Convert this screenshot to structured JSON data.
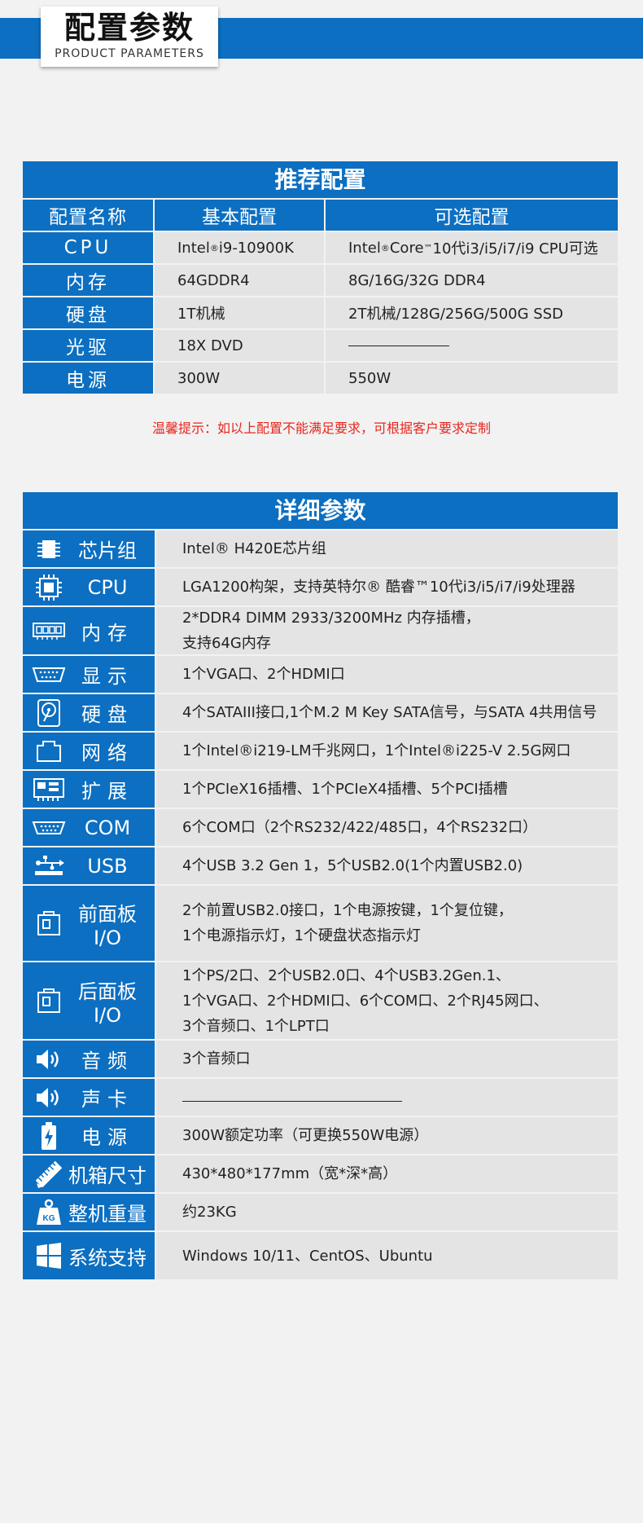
{
  "header": {
    "title_zh": "配置参数",
    "title_en": "PRODUCT PARAMETERS"
  },
  "recommended": {
    "title": "推荐配置",
    "columns": [
      "配置名称",
      "基本配置",
      "可选配置"
    ],
    "rows": [
      {
        "name": "CPU",
        "basic_a": "Intel",
        "basic_sup": "®",
        "basic_b": "i9-10900K",
        "optional_a": "Intel",
        "optional_sup": "®",
        "optional_b": "Core",
        "optional_sup2": "™",
        "optional_c": "10代i3/i5/i7/i9 CPU可选"
      },
      {
        "name": "内存",
        "basic_a": "64GDDR4",
        "optional_a": "8G/16G/32G DDR4"
      },
      {
        "name": "硬盘",
        "basic_a": "1T机械",
        "optional_a": "2T机械/128G/256G/500G SSD"
      },
      {
        "name": "光驱",
        "basic_a": "18X DVD",
        "optional_a": ""
      },
      {
        "name": "电源",
        "basic_a": "300W",
        "optional_a": "550W"
      }
    ]
  },
  "tip": "温馨提示：如以上配置不能满足要求，可根据客户要求定制",
  "detail": {
    "title": "详细参数",
    "rows": [
      {
        "icon": "chip-icon",
        "label": "芯片组",
        "lines": [
          "Intel® H420E芯片组"
        ]
      },
      {
        "icon": "cpu-icon",
        "label": "CPU",
        "lines": [
          "LGA1200构架，支持英特尔® 酷睿™10代i3/i5/i7/i9处理器"
        ]
      },
      {
        "icon": "memory-icon",
        "label": "内存",
        "lines": [
          "2*DDR4 DIMM 2933/3200MHz 内存插槽，",
          "支持64G内存"
        ]
      },
      {
        "icon": "vga-port-icon",
        "label": "显示",
        "lines": [
          "1个VGA口、2个HDMI口"
        ]
      },
      {
        "icon": "hard-disk-icon",
        "label": "硬盘",
        "lines": [
          "4个SATAIII接口,1个M.2 M Key SATA信号，与SATA 4共用信号"
        ]
      },
      {
        "icon": "network-icon",
        "label": "网络",
        "lines": [
          "1个Intel®i219-LM千兆网口，1个Intel®i225-V 2.5G网口"
        ]
      },
      {
        "icon": "expansion-icon",
        "label": "扩展",
        "lines": [
          "1个PCIeX16插槽、1个PCIeX4插槽、5个PCI插槽"
        ]
      },
      {
        "icon": "com-port-icon",
        "label": "COM",
        "lines": [
          "6个COM口（2个RS232/422/485口，4个RS232口）"
        ]
      },
      {
        "icon": "usb-icon",
        "label": "USB",
        "lines": [
          "4个USB 3.2 Gen 1，5个USB2.0(1个内置USB2.0)"
        ]
      },
      {
        "icon": "panel-icon",
        "label": "前面板I/O",
        "lines": [
          "2个前置USB2.0接口，1个电源按键，1个复位键，",
          "1个电源指示灯，1个硬盘状态指示灯"
        ]
      },
      {
        "icon": "panel-icon",
        "label": "后面板I/O",
        "lines": [
          "1个PS/2口、2个USB2.0口、4个USB3.2Gen.1、",
          "1个VGA口、2个HDMI口、6个COM口、2个RJ45网口、",
          "3个音频口、1个LPT口"
        ]
      },
      {
        "icon": "speaker-icon",
        "label": "音频",
        "lines": [
          "3个音频口"
        ]
      },
      {
        "icon": "speaker-icon",
        "label": "声卡",
        "lines": []
      },
      {
        "icon": "battery-icon",
        "label": "电源",
        "lines": [
          "300W额定功率（可更换550W电源）"
        ]
      },
      {
        "icon": "ruler-icon",
        "label": "机箱尺寸",
        "lines": [
          "430*480*177mm（宽*深*高）"
        ]
      },
      {
        "icon": "weight-icon",
        "label": "整机重量",
        "lines": [
          "约23KG"
        ]
      },
      {
        "icon": "windows-icon",
        "label": "系统支持",
        "lines": [
          "Windows 10/11、CentOS、Ubuntu"
        ]
      }
    ]
  },
  "colors": {
    "accent": "#0c6fc1",
    "cell_bg": "#e4e4e4",
    "tip": "#e8261e"
  }
}
